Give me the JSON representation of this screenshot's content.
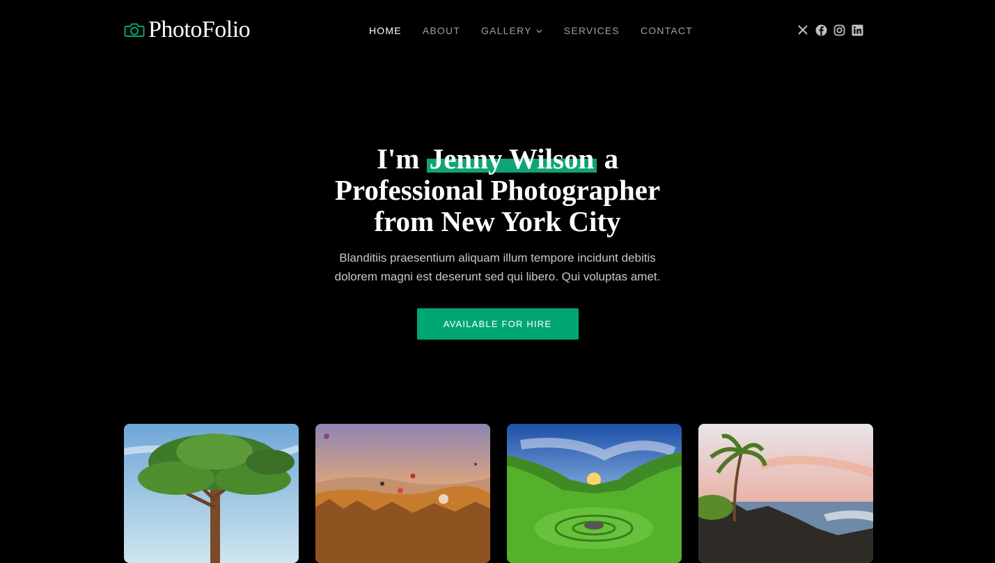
{
  "brand": {
    "name": "PhotoFolio",
    "icon": "camera-icon",
    "accent": "#00a774"
  },
  "nav": {
    "items": [
      {
        "label": "HOME",
        "active": true
      },
      {
        "label": "ABOUT",
        "active": false
      },
      {
        "label": "GALLERY",
        "active": false,
        "dropdown": true
      },
      {
        "label": "SERVICES",
        "active": false
      },
      {
        "label": "CONTACT",
        "active": false
      }
    ]
  },
  "social": [
    "x-icon",
    "facebook-icon",
    "instagram-icon",
    "linkedin-icon"
  ],
  "hero": {
    "title_prefix": "I'm ",
    "title_highlight": "Jenny Wilson",
    "title_suffix": " a",
    "title_line2": "Professional Photographer",
    "title_line3": "from New York City",
    "subtitle": "Blanditiis praesentium aliquam illum tempore incidunt debitis dolorem magni est deserunt sed qui libero. Qui voluptas amet.",
    "cta_label": "AVAILABLE FOR HIRE"
  },
  "gallery": [
    {
      "name": "tree-photo"
    },
    {
      "name": "balloons-photo"
    },
    {
      "name": "valley-sunset-photo"
    },
    {
      "name": "palm-beach-photo"
    }
  ],
  "colors": {
    "background": "#000000",
    "highlight": "#0ea476",
    "button": "#00a774"
  }
}
